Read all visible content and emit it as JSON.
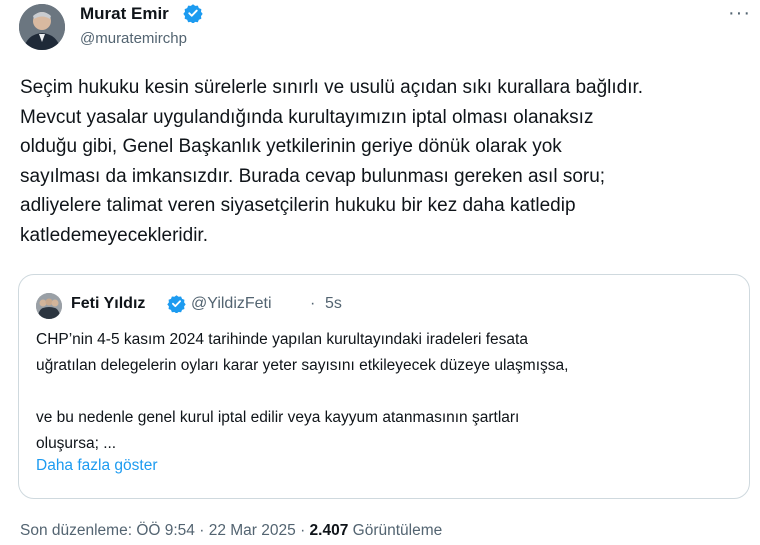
{
  "author": {
    "name": "Murat Emir",
    "handle": "@muratemirchp"
  },
  "more_menu": "···",
  "tweet": {
    "lines": [
      "Seçim hukuku kesin sürelerle sınırlı ve usulü açıdan sıkı kurallara bağlıdır.",
      "Mevcut yasalar uygulandığında kurultayımızın iptal olması olanaksız",
      "olduğu gibi, Genel Başkanlık yetkilerinin geriye dönük olarak yok",
      "sayılması da imkansızdır. Burada cevap bulunması gereken asıl soru;",
      "adliyelere talimat veren siyasetçilerin hukuku bir kez daha katledip",
      "katledemeyecekleridir."
    ]
  },
  "quote": {
    "name": "Feti Yıldız",
    "handle": "@YildizFeti",
    "separator": "·",
    "time": "5s",
    "lines": [
      "CHP’nin 4-5 kasım 2024 tarihinde yapılan kurultayındaki iradeleri fesata",
      "uğratılan delegelerin oyları  karar yeter sayısını etkileyecek düzeye ulaşmışsa,",
      "",
      "ve bu nedenle genel kurul iptal edilir veya kayyum atanmasının şartları",
      "oluşursa; ..."
    ],
    "show_more": "Daha fazla göster"
  },
  "meta": {
    "edited_label": "Son düzenleme: ÖÖ 9:54",
    "separator1": "·",
    "date": "22 Mar 2025",
    "separator2": "·",
    "views_count": "2.407",
    "views_label": "Görüntüleme"
  },
  "colors": {
    "verified": "#1d9bf0",
    "link": "#1d9bf0",
    "muted": "#536471",
    "border": "#cfd9de"
  }
}
